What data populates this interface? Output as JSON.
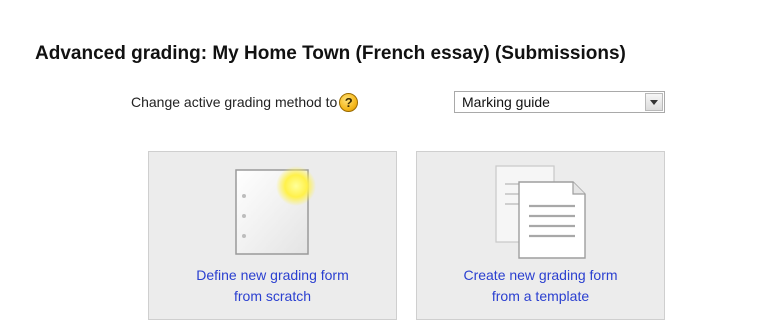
{
  "heading": "Advanced grading: My Home Town (French essay) (Submissions)",
  "method": {
    "label": "Change active grading method to",
    "help_icon": "help-question-icon",
    "selected": "Marking guide"
  },
  "options": [
    {
      "line1": "Define new grading form",
      "line2": "from scratch",
      "icon": "blank-form-icon"
    },
    {
      "line1": "Create new grading form",
      "line2": "from a template",
      "icon": "template-documents-icon"
    }
  ],
  "colors": {
    "link": "#2a3fd0",
    "tile_bg": "#ececec",
    "help_icon": "#f5b81c"
  }
}
